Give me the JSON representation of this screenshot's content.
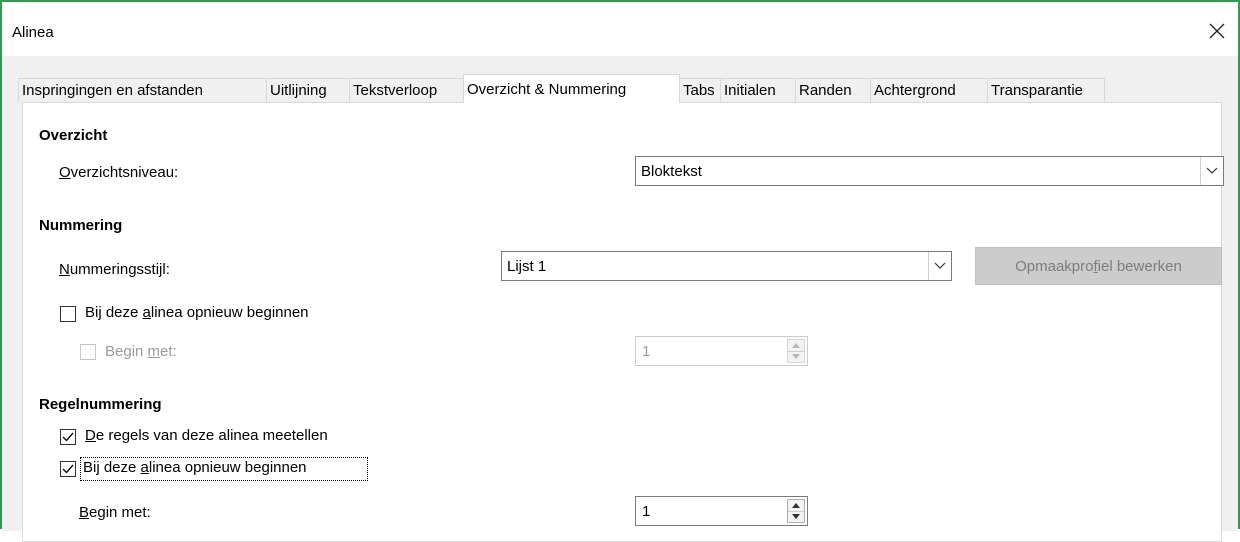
{
  "window": {
    "title": "Alinea"
  },
  "tabs": [
    "Inspringingen en afstanden",
    "Uitlijning",
    "Tekstverloop",
    "Overzicht & Nummering",
    "Tabs",
    "Initialen",
    "Randen",
    "Achtergrond",
    "Transparantie"
  ],
  "active_tab": "Overzicht & Nummering",
  "outline": {
    "heading": "Overzicht",
    "level_label_first": "O",
    "level_label_rest": "verzichtsniveau:",
    "level_value": "Bloktekst"
  },
  "numbering": {
    "heading": "Nummering",
    "style_label_first": "N",
    "style_label_rest": "ummeringsstijl:",
    "style_value": "Lijst 1",
    "edit_button_pre": "Opmaakpro",
    "edit_button_u": "f",
    "edit_button_post": "iel bewerken",
    "restart_pre": "Bij deze ",
    "restart_u": "a",
    "restart_post": "linea opnieuw beginnen",
    "restart_checked": false,
    "start_label_pre": "Begin ",
    "start_label_u": "m",
    "start_label_post": "et:",
    "start_checked": false,
    "start_value": "1"
  },
  "line_numbering": {
    "heading": "Regelnummering",
    "count_u": "D",
    "count_rest": "e regels van deze alinea meetellen",
    "count_checked": true,
    "restart_pre": "Bij deze ",
    "restart_u": "a",
    "restart_post": "linea opnieuw beginnen",
    "restart_checked": true,
    "start_label_u": "B",
    "start_label_rest": "egin met:",
    "start_value": "1"
  }
}
